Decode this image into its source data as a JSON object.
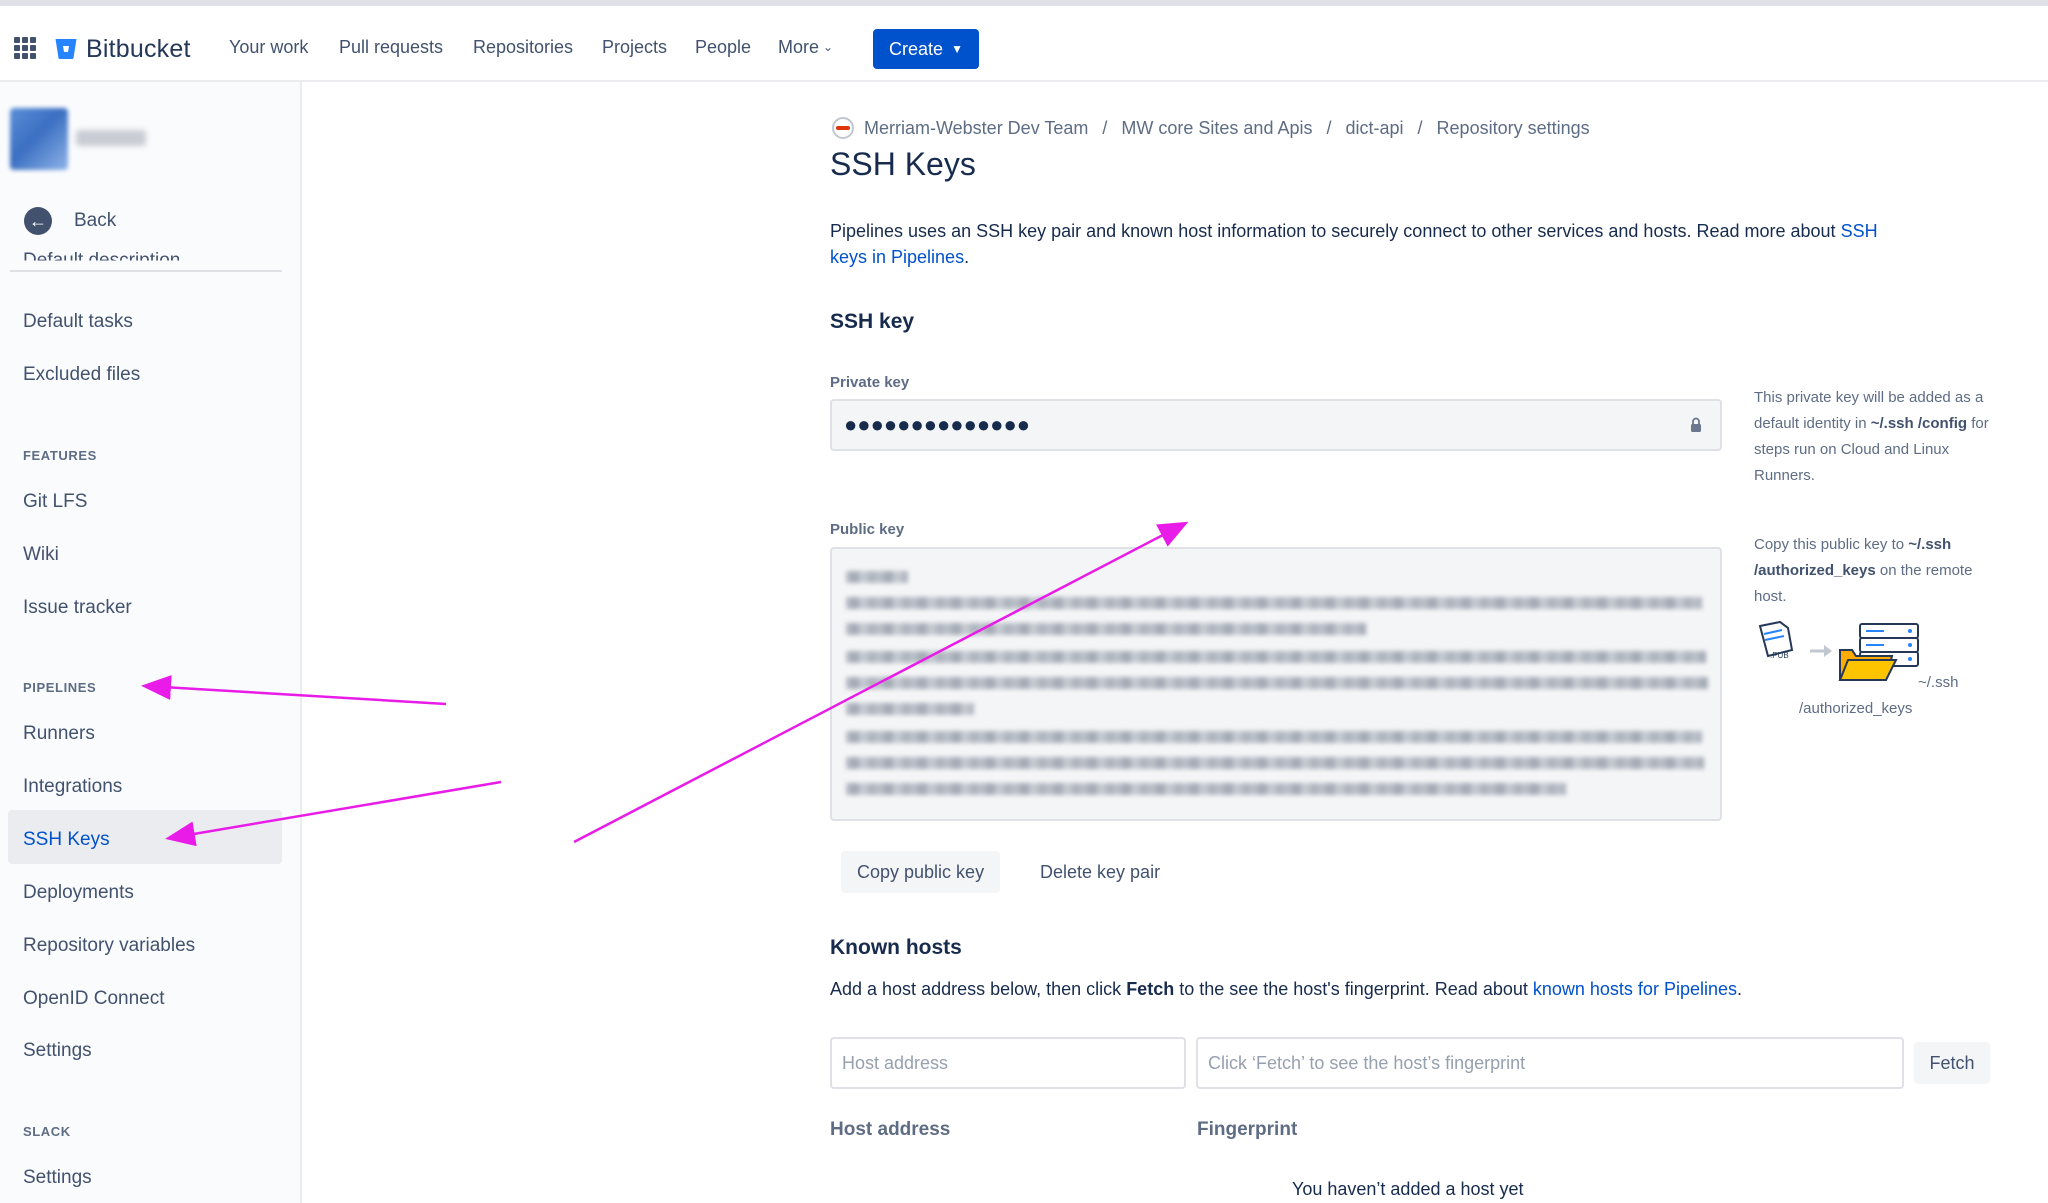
{
  "app": {
    "name": "Bitbucket",
    "logo_icon": "bitbucket-logo-icon",
    "apps_icon": "app-switcher-icon"
  },
  "topnav": {
    "items": [
      {
        "label": "Your work"
      },
      {
        "label": "Pull requests"
      },
      {
        "label": "Repositories"
      },
      {
        "label": "Projects"
      },
      {
        "label": "People"
      },
      {
        "label": "More"
      }
    ],
    "more_icon": "chevron-down-icon",
    "create_label": "Create",
    "create_icon": "chevron-down-icon"
  },
  "sidebar": {
    "back_label": "Back",
    "back_icon": "arrow-left-circle-icon",
    "partial_item": "Default description",
    "items_top": [
      {
        "label": "Default tasks"
      },
      {
        "label": "Excluded files"
      }
    ],
    "features": {
      "heading": "FEATURES",
      "items": [
        {
          "label": "Git LFS"
        },
        {
          "label": "Wiki"
        },
        {
          "label": "Issue tracker"
        }
      ]
    },
    "pipelines": {
      "heading": "PIPELINES",
      "items": [
        {
          "label": "Runners"
        },
        {
          "label": "Integrations"
        },
        {
          "label": "SSH Keys",
          "active": true
        },
        {
          "label": "Deployments"
        },
        {
          "label": "Repository variables"
        },
        {
          "label": "OpenID Connect"
        },
        {
          "label": "Settings"
        }
      ]
    },
    "slack": {
      "heading": "SLACK",
      "items": [
        {
          "label": "Settings"
        }
      ]
    }
  },
  "breadcrumb": {
    "items": [
      "Merriam-Webster Dev Team",
      "MW core Sites and Apis",
      "dict-api",
      "Repository settings"
    ],
    "separator": "/"
  },
  "page": {
    "title": "SSH Keys",
    "intro_text": "Pipelines uses an SSH key pair and known host information to securely connect to other services and hosts. Read more about ",
    "intro_link": "SSH keys in Pipelines",
    "intro_end": "."
  },
  "ssh_key": {
    "section_title": "SSH key",
    "private_label": "Private key",
    "private_value": "●●●●●●●●●●●●●●",
    "lock_icon": "lock-icon",
    "private_help_1": "This private key will be added as a default identity in ",
    "private_help_path": "~/.ssh /config",
    "private_help_2": " for steps run on Cloud and Linux Runners.",
    "public_label": "Public key",
    "public_help_1": "Copy this public key to ",
    "public_help_path": "~/.ssh /authorized_keys",
    "public_help_2": " on the remote host.",
    "illustration_path": "~/.ssh",
    "illustration_file": "/authorized_keys",
    "illustration_badge": ".PUB",
    "copy_button": "Copy public key",
    "delete_button": "Delete key pair"
  },
  "known_hosts": {
    "section_title": "Known hosts",
    "desc_1": "Add a host address below, then click ",
    "desc_bold": "Fetch",
    "desc_2": " to the see the host's fingerprint. Read about ",
    "desc_link": "known hosts for Pipelines",
    "desc_end": ".",
    "host_placeholder": "Host address",
    "fingerprint_placeholder": "Click ‘Fetch’ to see the host’s fingerprint",
    "fetch_button": "Fetch",
    "col_host": "Host address",
    "col_fingerprint": "Fingerprint",
    "empty": "You haven’t added a host yet"
  },
  "colors": {
    "primary": "#0052CC",
    "annotation": "#E81BE8",
    "text": "#172B4D",
    "subtle": "#42526E"
  }
}
